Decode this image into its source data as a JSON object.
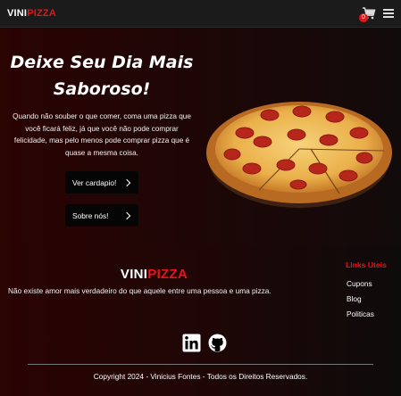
{
  "navbar": {
    "logo_part1": "VINI",
    "logo_part2": "PIZZA",
    "cart_count": "0",
    "cart_icon": "cart-icon",
    "menu_icon": "menu-icon"
  },
  "hero": {
    "title_line1": "Deixe Seu Dia Mais",
    "title_line2": "Saboroso!",
    "description": "Quando não souber o que comer, coma uma pizza que você ficará feliz, já que você não pode comprar felicidade, mas pelo menos pode comprar pizza que é quase a mesma coisa.",
    "buttons": [
      {
        "label": "Ver cardapio!",
        "icon": "chevron-right-icon"
      },
      {
        "label": "Sobre nós!",
        "icon": "chevron-right-icon"
      }
    ]
  },
  "footer": {
    "logo_part1": "VINI",
    "logo_part2": "PIZZA",
    "tagline": "Não existe amor mais verdadeiro do que aquele entre uma pessoa e uma pizza.",
    "links_title": "Links Uteis",
    "links": [
      "Cupons",
      "Blog",
      "Politicas"
    ],
    "social": [
      "linkedin-icon",
      "github-icon"
    ],
    "copyright": "Copyright 2024 - Vinicius Fontes - Todos os Direitos Reservados."
  },
  "colors": {
    "accent": "#e8141a",
    "navbar_bg": "#1b1b1b",
    "hero_bg": "#2a0303",
    "button_bg": "#050505"
  }
}
